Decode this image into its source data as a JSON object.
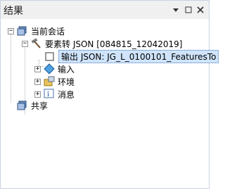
{
  "panel": {
    "title": "结果",
    "buttons": {
      "pin": "▢",
      "autohide": "⊓",
      "close": "✕"
    }
  },
  "tree": {
    "session": {
      "label": "当前会话",
      "expander": "−"
    },
    "tool": {
      "label": "要素转 JSON [084815_12042019]",
      "expander": "−"
    },
    "output": {
      "label": "输出 JSON: JG_L_0100101_FeaturesTo"
    },
    "inputs": {
      "label": "输入",
      "expander": "+"
    },
    "env": {
      "label": "环境",
      "expander": "+"
    },
    "messages": {
      "label": "消息",
      "expander": "+"
    },
    "shared": {
      "label": "共享"
    }
  },
  "colors": {
    "selection": "#cfe4fb",
    "titlebar": "#f0f0f0",
    "border": "#c9d3e0"
  }
}
